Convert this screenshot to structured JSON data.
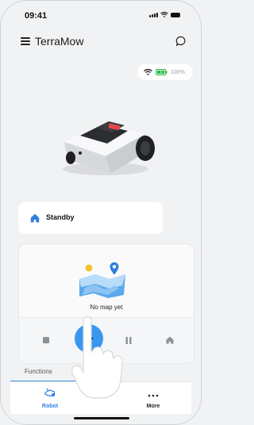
{
  "status_bar": {
    "time": "09:41"
  },
  "header": {
    "title": "TerraMow"
  },
  "connection": {
    "battery_pct": "100%"
  },
  "robot_status": {
    "label": "Standby"
  },
  "map": {
    "empty_text": "No map yet"
  },
  "sections": {
    "functions_label": "Functions"
  },
  "tabs": [
    {
      "label": "Robot",
      "active": true
    },
    {
      "label": "More",
      "active": false
    }
  ],
  "colors": {
    "accent": "#3a97f0",
    "battery": "#2db84b",
    "home_icon": "#2f7fe0"
  },
  "icons": [
    "menu-icon",
    "chat-icon",
    "wifi-icon",
    "battery-icon",
    "home-icon",
    "map-illustration-icon",
    "stop-icon",
    "play-icon",
    "pause-icon",
    "dock-icon",
    "robot-tab-icon",
    "more-icon"
  ]
}
